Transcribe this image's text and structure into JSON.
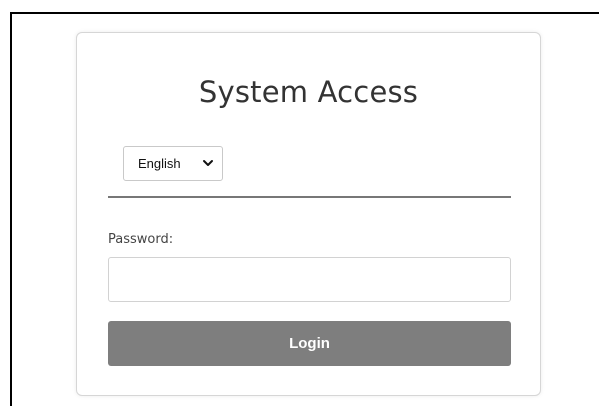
{
  "login": {
    "title": "System Access",
    "language": {
      "selected": "English"
    },
    "password": {
      "label": "Password:",
      "value": "",
      "placeholder": ""
    },
    "submit_label": "Login"
  },
  "colors": {
    "button_bg": "#7e7e7e",
    "button_text": "#ffffff",
    "title_text": "#333333",
    "divider": "#777777"
  },
  "icons": {
    "language_select": "chevron-down-icon"
  }
}
